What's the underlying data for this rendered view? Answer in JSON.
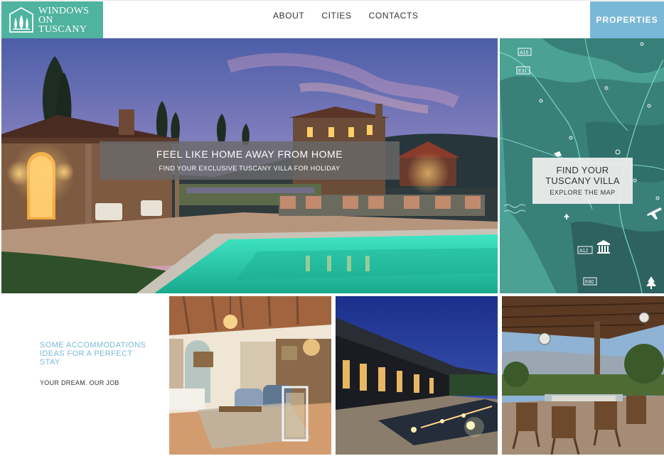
{
  "header": {
    "logo_line1": "WINDOWS",
    "logo_line2": "ON TUSCANY",
    "nav": [
      "ABOUT",
      "CITIES",
      "CONTACTS"
    ],
    "properties_label": "PROPERTIES"
  },
  "hero": {
    "title": "FEEL LIKE HOME AWAY FROM HOME",
    "subtitle": "FIND YOUR EXCLUSIVE TUSCANY VILLA FOR HOLIDAY"
  },
  "map": {
    "title_line1": "FIND YOUR",
    "title_line2": "TUSCANY VILLA",
    "cta": "EXPLORE THE MAP",
    "road_labels": [
      "A15",
      "E31",
      "A12",
      "E80"
    ]
  },
  "intro": {
    "title": "SOME ACCOMMODATIONS IDEAS FOR A PERFECT STAY",
    "tagline": "YOUR DREAM. OUR JOB"
  },
  "colors": {
    "brand_green": "#4fb39f",
    "properties_blue": "#7ab8d7",
    "map_teal": "#48998d"
  }
}
